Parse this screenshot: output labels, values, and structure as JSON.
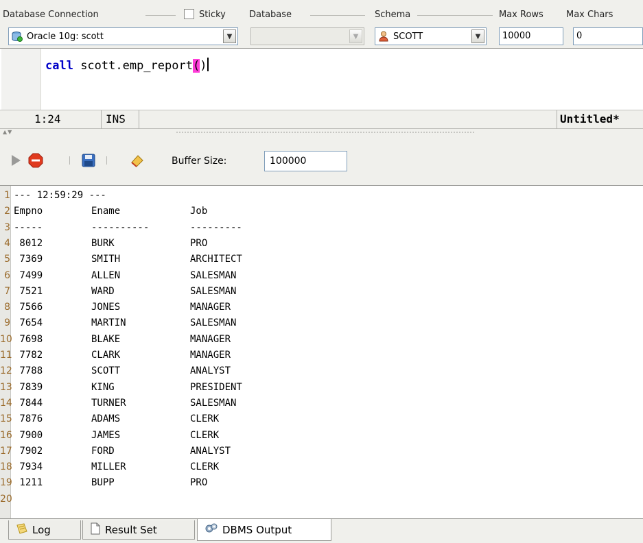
{
  "connection_bar": {
    "labels": {
      "database_connection": "Database Connection",
      "sticky": "Sticky",
      "database": "Database",
      "schema": "Schema",
      "max_rows": "Max Rows",
      "max_chars": "Max Chars"
    },
    "sticky_checked": false,
    "connection_value": "Oracle 10g: scott",
    "database_value": "",
    "schema_value": "SCOTT",
    "max_rows_value": "10000",
    "max_chars_value": "0"
  },
  "editor": {
    "keyword": "call",
    "statement_before": " scott.emp_report",
    "paren_open": "(",
    "paren_close": ")"
  },
  "status_bar": {
    "position": "1:24",
    "mode": "INS",
    "doc_name": "Untitled*"
  },
  "output_toolbar": {
    "buffer_label": "Buffer Size:",
    "buffer_value": "100000"
  },
  "output": {
    "lines": [
      {
        "n": "1",
        "c1": "--- 12:59:29 ---",
        "c2": "",
        "c3": ""
      },
      {
        "n": "2",
        "c1": "Empno",
        "c2": "Ename",
        "c3": "Job"
      },
      {
        "n": "3",
        "c1": "-----",
        "c2": "----------",
        "c3": "---------"
      },
      {
        "n": "4",
        "c1": " 8012",
        "c2": "BURK",
        "c3": "PRO"
      },
      {
        "n": "5",
        "c1": " 7369",
        "c2": "SMITH",
        "c3": "ARCHITECT"
      },
      {
        "n": "6",
        "c1": " 7499",
        "c2": "ALLEN",
        "c3": "SALESMAN"
      },
      {
        "n": "7",
        "c1": " 7521",
        "c2": "WARD",
        "c3": "SALESMAN"
      },
      {
        "n": "8",
        "c1": " 7566",
        "c2": "JONES",
        "c3": "MANAGER"
      },
      {
        "n": "9",
        "c1": " 7654",
        "c2": "MARTIN",
        "c3": "SALESMAN"
      },
      {
        "n": "10",
        "c1": " 7698",
        "c2": "BLAKE",
        "c3": "MANAGER"
      },
      {
        "n": "11",
        "c1": " 7782",
        "c2": "CLARK",
        "c3": "MANAGER"
      },
      {
        "n": "12",
        "c1": " 7788",
        "c2": "SCOTT",
        "c3": "ANALYST"
      },
      {
        "n": "13",
        "c1": " 7839",
        "c2": "KING",
        "c3": "PRESIDENT"
      },
      {
        "n": "14",
        "c1": " 7844",
        "c2": "TURNER",
        "c3": "SALESMAN"
      },
      {
        "n": "15",
        "c1": " 7876",
        "c2": "ADAMS",
        "c3": "CLERK"
      },
      {
        "n": "16",
        "c1": " 7900",
        "c2": "JAMES",
        "c3": "CLERK"
      },
      {
        "n": "17",
        "c1": " 7902",
        "c2": "FORD",
        "c3": "ANALYST"
      },
      {
        "n": "18",
        "c1": " 7934",
        "c2": "MILLER",
        "c3": "CLERK"
      },
      {
        "n": "19",
        "c1": " 1211",
        "c2": "BUPP",
        "c3": "PRO"
      },
      {
        "n": "20",
        "c1": "",
        "c2": "",
        "c3": ""
      }
    ]
  },
  "bottom_tabs": [
    {
      "label": "Log",
      "icon": "log-icon",
      "active": false
    },
    {
      "label": "Result Set",
      "icon": "result-set-icon",
      "active": false
    },
    {
      "label": "DBMS Output",
      "icon": "dbms-output-icon",
      "active": true
    }
  ],
  "colors": {
    "keyword": "#0000c8",
    "bracket_highlight": "#ff3cd8",
    "line_number": "#9a6a2a",
    "panel_background": "#f0f0ec"
  },
  "icons": [
    "database-connection-icon",
    "schema-user-icon",
    "run-icon",
    "stop-icon",
    "save-icon",
    "clear-output-icon",
    "chevron-down-icon"
  ]
}
